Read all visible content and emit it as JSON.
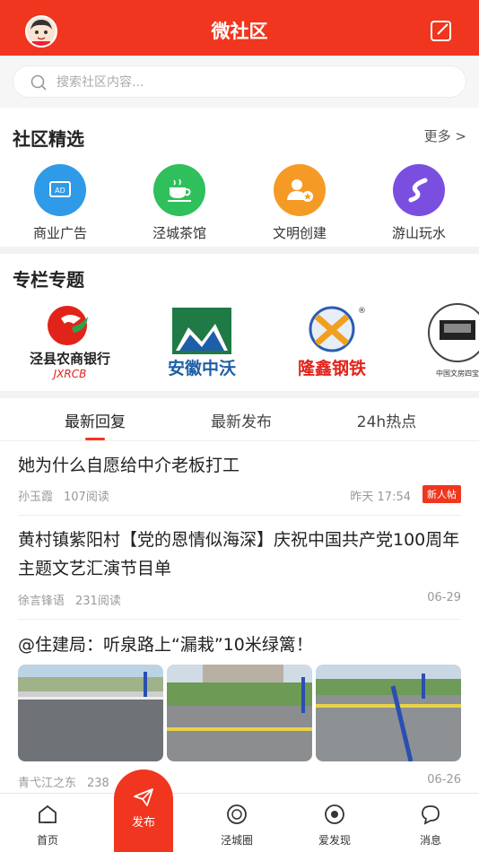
{
  "header": {
    "title": "微社区"
  },
  "search": {
    "placeholder": "搜索社区内容..."
  },
  "picks": {
    "title": "社区精选",
    "more": "更多 >",
    "items": [
      {
        "label": "商业广告",
        "color": "#2f9ae8",
        "icon": "ad-icon"
      },
      {
        "label": "泾城茶馆",
        "color": "#2fbf5b",
        "icon": "teacup-icon"
      },
      {
        "label": "文明创建",
        "color": "#f59b25",
        "icon": "user-star-icon"
      },
      {
        "label": "游山玩水",
        "color": "#7a4fe0",
        "icon": "river-icon"
      }
    ]
  },
  "columns": {
    "title": "专栏专题",
    "logos": [
      {
        "line1": "泾县农商银行",
        "line2": "JXRCB"
      },
      {
        "line1": "安徽中沃"
      },
      {
        "line1": "隆鑫钢铁"
      },
      {
        "line1": "中国文房四宝"
      }
    ]
  },
  "tabs": [
    "最新回复",
    "最新发布",
    "24h热点"
  ],
  "posts": [
    {
      "title": "她为什么自愿给中介老板打工",
      "author": "孙玉霞",
      "views": "107阅读",
      "date": "昨天 17:54",
      "badge": "新人帖"
    },
    {
      "title": "黄村镇紫阳村【党的恩情似海深】庆祝中国共产党100周年主题文艺汇演节目单",
      "author": "徐言锋语",
      "views": "231阅读",
      "date": "06-29"
    },
    {
      "title": "@住建局：听泉路上“漏栽”10米绿篱！",
      "author": "青弋江之东",
      "views": "238",
      "date": "06-26"
    }
  ],
  "nav": {
    "items": [
      "首页",
      "发布",
      "泾城圈",
      "爱发现",
      "消息"
    ]
  }
}
